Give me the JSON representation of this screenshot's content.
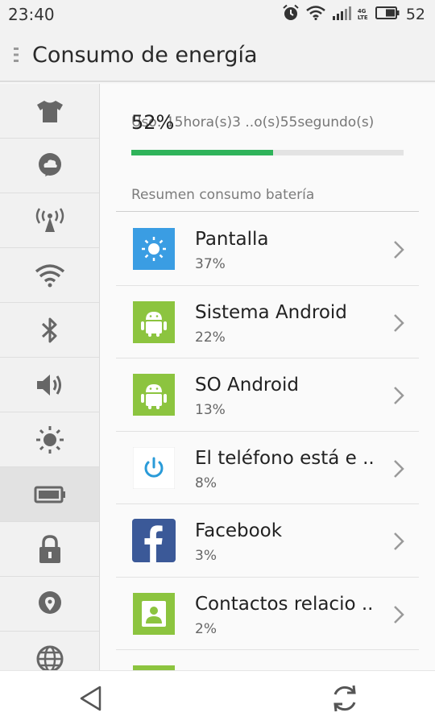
{
  "status_bar": {
    "time": "23:40",
    "network_label": "4G LTE",
    "battery_level": "52",
    "icons": [
      "alarm-icon",
      "wifi-icon",
      "signal-icon",
      "battery-icon"
    ]
  },
  "app_bar": {
    "title": "Consumo de energía"
  },
  "sidebar": {
    "items": [
      {
        "icon": "tshirt-icon"
      },
      {
        "icon": "cloud-chat-icon"
      },
      {
        "icon": "hotspot-antenna-icon"
      },
      {
        "icon": "wifi-icon"
      },
      {
        "icon": "bluetooth-icon"
      },
      {
        "icon": "volume-icon"
      },
      {
        "icon": "brightness-icon"
      },
      {
        "icon": "battery-icon",
        "active": true
      },
      {
        "icon": "lock-icon"
      },
      {
        "icon": "location-pin-icon"
      },
      {
        "icon": "globe-icon"
      }
    ]
  },
  "usage": {
    "percent": "52%",
    "percent_value": 0.52,
    "time_text": "Uso: 15hora(s)3 ..o(s)55segundo(s)"
  },
  "summary": {
    "label": "Resumen consumo batería",
    "items": [
      {
        "name": "Pantalla",
        "percent": "37%",
        "icon": "brightness-sun-icon"
      },
      {
        "name": "Sistema Android",
        "percent": "22%",
        "icon": "android-icon"
      },
      {
        "name": "SO Android",
        "percent": "13%",
        "icon": "android-icon"
      },
      {
        "name": "El teléfono está e ..",
        "percent": "8%",
        "icon": "power-icon"
      },
      {
        "name": "Facebook",
        "percent": "3%",
        "icon": "facebook-icon"
      },
      {
        "name": "Contactos relacio ..",
        "percent": "2%",
        "icon": "contact-icon"
      }
    ]
  },
  "colors": {
    "progress": "#2fb35a",
    "android_green": "#8cc43f",
    "display_blue": "#3a9de3",
    "facebook_blue": "#3b5998"
  },
  "nav": {
    "icons": [
      "back-icon",
      "refresh-icon"
    ]
  }
}
